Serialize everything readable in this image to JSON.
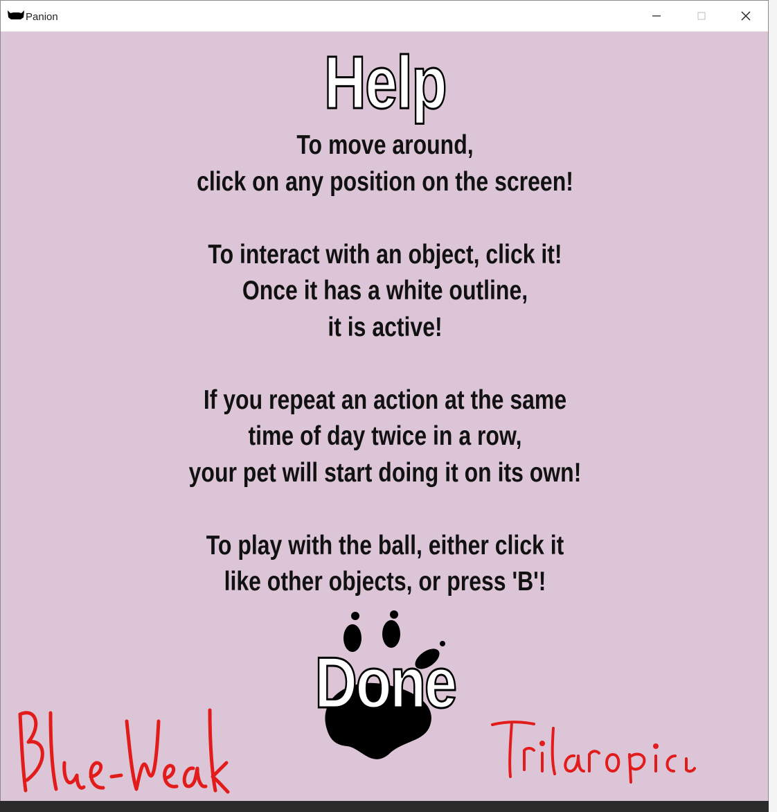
{
  "window": {
    "title": "Panion",
    "icon": "cat-icon",
    "controls": {
      "minimize_icon": "minimize-icon",
      "maximize_icon": "maximize-icon",
      "close_icon": "close-icon"
    },
    "background_color": "#dcc5d6"
  },
  "help": {
    "title": "Help",
    "paragraphs": [
      {
        "lines": [
          "To move around,",
          "click on any position on the screen!"
        ]
      },
      {
        "lines": [
          "To interact with an object, click it!",
          "Once it has a white outline,",
          "it is active!"
        ]
      },
      {
        "lines": [
          "If you repeat an action at the same",
          "time of day twice in a row,",
          "your pet will start doing it on its own!"
        ]
      },
      {
        "lines": [
          "To play with the ball, either click it",
          "like other objects, or press 'B'!"
        ]
      }
    ]
  },
  "done_button": {
    "label": "Done",
    "decoration_icon": "paw-print-icon"
  },
  "annotations": {
    "left": "Blue-Weak",
    "right": "Tritanopia",
    "ink_color": "#e21b1b"
  }
}
